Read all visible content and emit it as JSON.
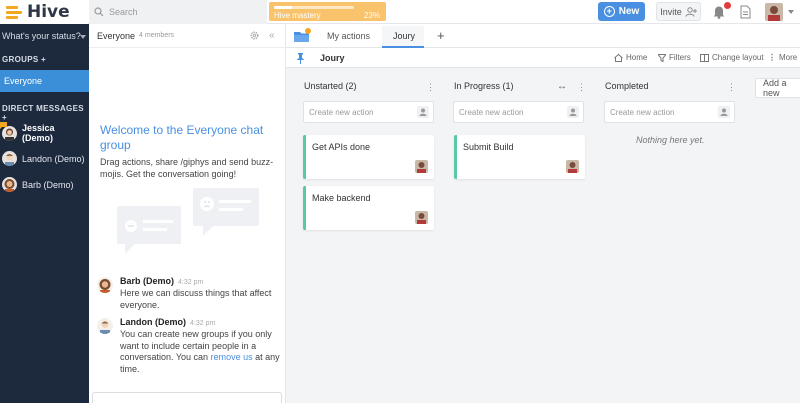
{
  "app": {
    "name": "Hive",
    "brand_color": "#f5a623",
    "accent_color": "#4a90e2"
  },
  "topbar": {
    "search_placeholder": "Search",
    "mastery_label": "Hive mastery",
    "mastery_percent": "23%",
    "mastery_fraction": 0.23,
    "new_label": "New",
    "invite_label": "Invite"
  },
  "sidebar": {
    "status_placeholder": "What's your status?",
    "groups_label": "GROUPS +",
    "groups": [
      {
        "label": "Everyone"
      }
    ],
    "dm_label": "DIRECT MESSAGES +",
    "dms": [
      {
        "label": "Jessica (Demo)"
      },
      {
        "label": "Landon (Demo)"
      },
      {
        "label": "Barb (Demo)"
      }
    ]
  },
  "chat": {
    "group_name": "Everyone",
    "member_count": "4 members",
    "welcome_title": "Welcome to the Everyone chat group",
    "welcome_body": "Drag actions, share /giphys and send buzz-mojis. Get the conversation going!",
    "messages": [
      {
        "author": "Barb (Demo)",
        "time": "4:32 pm",
        "text": "Here we can discuss things that affect everyone."
      },
      {
        "author": "Landon (Demo)",
        "time": "4:32 pm",
        "text_before": "You can create new groups if you only want to include certain people in a conversation. You can ",
        "link": "remove us",
        "text_after": " at any time."
      }
    ]
  },
  "board": {
    "tabs": [
      {
        "label": "My actions"
      },
      {
        "label": "Joury"
      }
    ],
    "project_title": "Joury",
    "tools": {
      "home": "Home",
      "filters": "Filters",
      "layout": "Change layout",
      "more": "More"
    },
    "new_action_placeholder": "Create new action",
    "columns": [
      {
        "title": "Unstarted (2)",
        "cards": [
          {
            "title": "Get APIs done"
          },
          {
            "title": "Make backend"
          }
        ]
      },
      {
        "title": "In Progress (1)",
        "cards": [
          {
            "title": "Submit Build"
          }
        ]
      },
      {
        "title": "Completed",
        "empty": "Nothing here yet."
      }
    ],
    "add_new_label": "Add a new"
  }
}
